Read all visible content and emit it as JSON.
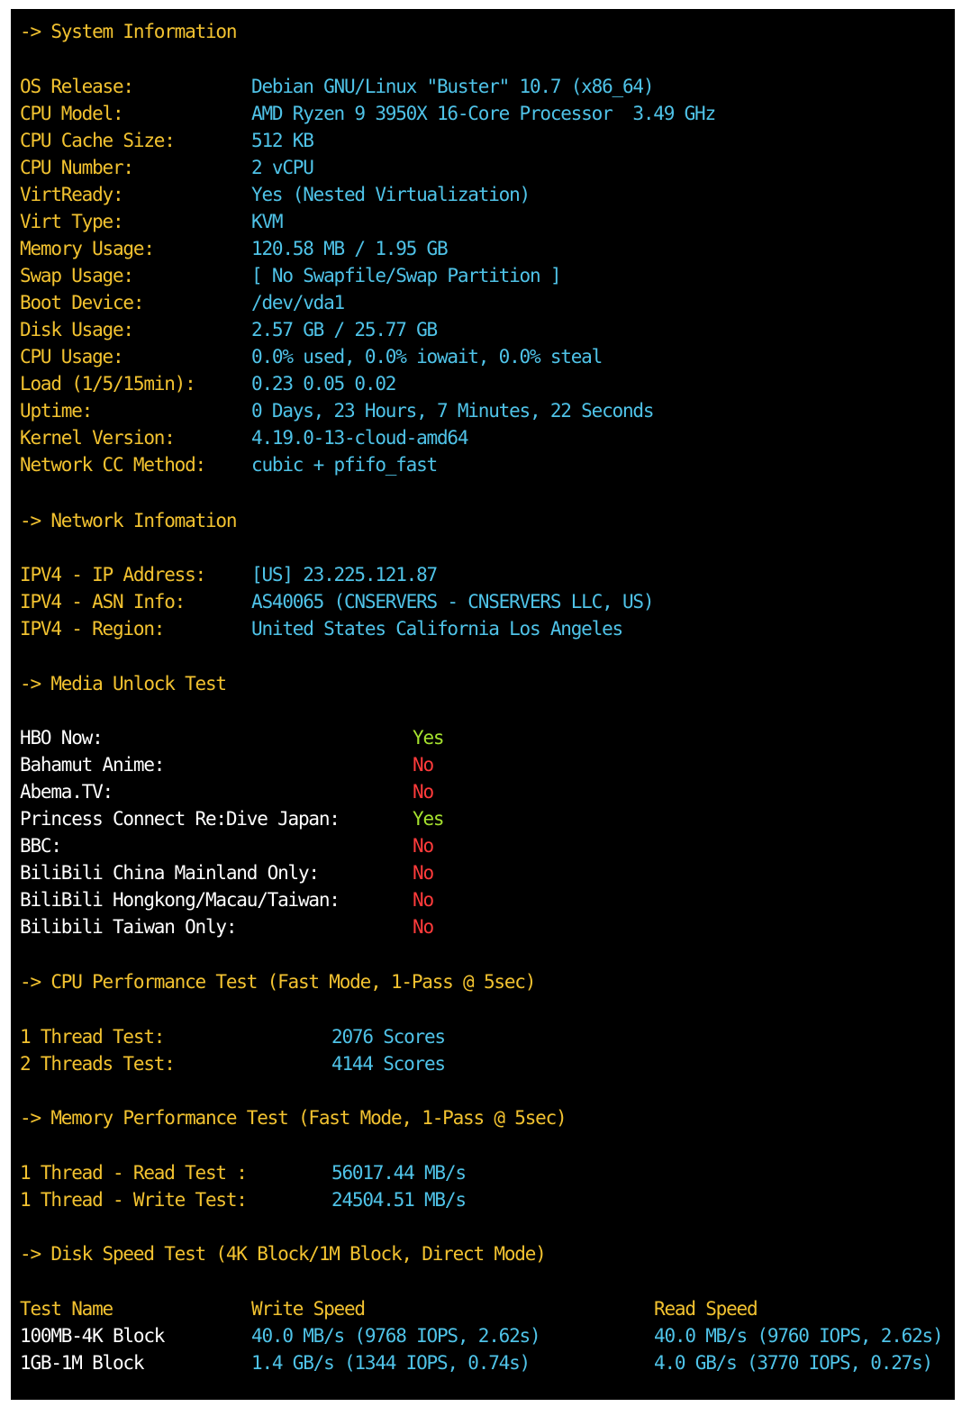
{
  "sections": {
    "system": "-> System Information",
    "network": "-> Network Infomation",
    "media": "-> Media Unlock Test",
    "cpu": "-> CPU Performance Test (Fast Mode, 1-Pass @ 5sec)",
    "memory": "-> Memory Performance Test (Fast Mode, 1-Pass @ 5sec)",
    "disk": "-> Disk Speed Test (4K Block/1M Block, Direct Mode)"
  },
  "system_info": [
    {
      "label": "OS Release:",
      "value": "Debian GNU/Linux \"Buster\" 10.7 (x86_64)"
    },
    {
      "label": "CPU Model:",
      "value": "AMD Ryzen 9 3950X 16-Core Processor  3.49 GHz"
    },
    {
      "label": "CPU Cache Size:",
      "value": "512 KB"
    },
    {
      "label": "CPU Number:",
      "value": "2 vCPU"
    },
    {
      "label": "VirtReady:",
      "value": "Yes (Nested Virtualization)"
    },
    {
      "label": "Virt Type:",
      "value": "KVM"
    },
    {
      "label": "Memory Usage:",
      "value": "120.58 MB / 1.95 GB"
    },
    {
      "label": "Swap Usage:",
      "value": "[ No Swapfile/Swap Partition ]"
    },
    {
      "label": "Boot Device:",
      "value": "/dev/vda1"
    },
    {
      "label": "Disk Usage:",
      "value": "2.57 GB / 25.77 GB"
    },
    {
      "label": "CPU Usage:",
      "value": "0.0% used, 0.0% iowait, 0.0% steal"
    },
    {
      "label": "Load (1/5/15min):",
      "value": "0.23 0.05 0.02"
    },
    {
      "label": "Uptime:",
      "value": "0 Days, 23 Hours, 7 Minutes, 22 Seconds"
    },
    {
      "label": "Kernel Version:",
      "value": "4.19.0-13-cloud-amd64"
    },
    {
      "label": "Network CC Method:",
      "value": "cubic + pfifo_fast"
    }
  ],
  "network_info": [
    {
      "label": "IPV4 - IP Address:",
      "value": "[US] 23.225.121.87"
    },
    {
      "label": "IPV4 - ASN Info:",
      "value": "AS40065 (CNSERVERS - CNSERVERS LLC, US)"
    },
    {
      "label": "IPV4 - Region:",
      "value": "United States California Los Angeles"
    }
  ],
  "media_unlock": [
    {
      "label": "HBO Now:",
      "value": "Yes"
    },
    {
      "label": "Bahamut Anime:",
      "value": "No"
    },
    {
      "label": "Abema.TV:",
      "value": "No"
    },
    {
      "label": "Princess Connect Re:Dive Japan:",
      "value": "Yes"
    },
    {
      "label": "BBC:",
      "value": "No"
    },
    {
      "label": "BiliBili China Mainland Only:",
      "value": "No"
    },
    {
      "label": "BiliBili Hongkong/Macau/Taiwan:",
      "value": "No"
    },
    {
      "label": "Bilibili Taiwan Only:",
      "value": "No"
    }
  ],
  "cpu_perf": [
    {
      "label": "1 Thread Test:",
      "value": "2076 Scores"
    },
    {
      "label": "2 Threads Test:",
      "value": "4144 Scores"
    }
  ],
  "memory_perf": [
    {
      "label": "1 Thread - Read Test :",
      "value": "56017.44 MB/s"
    },
    {
      "label": "1 Thread - Write Test:",
      "value": "24504.51 MB/s"
    }
  ],
  "disk_speed": {
    "headers": {
      "name": "Test Name",
      "write": "Write Speed",
      "read": "Read Speed"
    },
    "rows": [
      {
        "name": "100MB-4K Block",
        "write": "40.0 MB/s (9768 IOPS, 2.62s)",
        "read": "40.0 MB/s (9760 IOPS, 2.62s)"
      },
      {
        "name": "1GB-1M Block",
        "write": "1.4 GB/s (1344 IOPS, 0.74s)",
        "read": "4.0 GB/s (3770 IOPS, 0.27s)"
      }
    ]
  },
  "colors": {
    "background": "#000000",
    "heading": "#f2c230",
    "value": "#4fc3e8",
    "yes": "#a6e22e",
    "no": "#ff3b3b"
  }
}
